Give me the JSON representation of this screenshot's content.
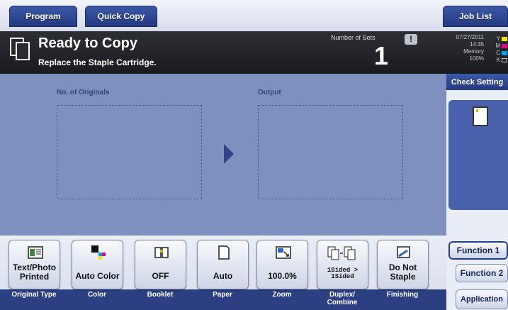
{
  "top_tabs": {
    "program": "Program",
    "quick_copy": "Quick Copy",
    "job_list": "Job List"
  },
  "status": {
    "title": "Ready to Copy",
    "message": "Replace the Staple Cartridge.",
    "sets_label": "Number of Sets",
    "sets_value": "1",
    "warning_icon": "!",
    "date": "07/27/2011",
    "time": "14:35",
    "memory_label": "Memory",
    "memory_value": "100%",
    "toner": [
      {
        "label": "Y",
        "color": "#f5e400"
      },
      {
        "label": "M",
        "color": "#e4007f"
      },
      {
        "label": "C",
        "color": "#00a0e9"
      },
      {
        "label": "K",
        "color": "#222222"
      }
    ]
  },
  "main": {
    "originals_label": "No. of Originals",
    "output_label": "Output"
  },
  "side": {
    "check_setting": "Check Setting"
  },
  "functions": [
    {
      "icon": "original-type-icon",
      "value": "Text/Photo Printed",
      "label": "Original Type"
    },
    {
      "icon": "color-icon",
      "value": "Auto Color",
      "label": "Color"
    },
    {
      "icon": "booklet-icon",
      "value": "OFF",
      "label": "Booklet"
    },
    {
      "icon": "paper-icon",
      "value": "Auto",
      "label": "Paper"
    },
    {
      "icon": "zoom-icon",
      "value": "100.0%",
      "label": "Zoom"
    },
    {
      "icon": "duplex-icon",
      "value": "1Sided > 1Sided",
      "label": "Duplex/ Combine"
    },
    {
      "icon": "finishing-icon",
      "value": "Do Not Staple",
      "label": "Finishing"
    }
  ],
  "right_tabs": {
    "function1": "Function 1",
    "function2": "Function 2",
    "application": "Application"
  }
}
